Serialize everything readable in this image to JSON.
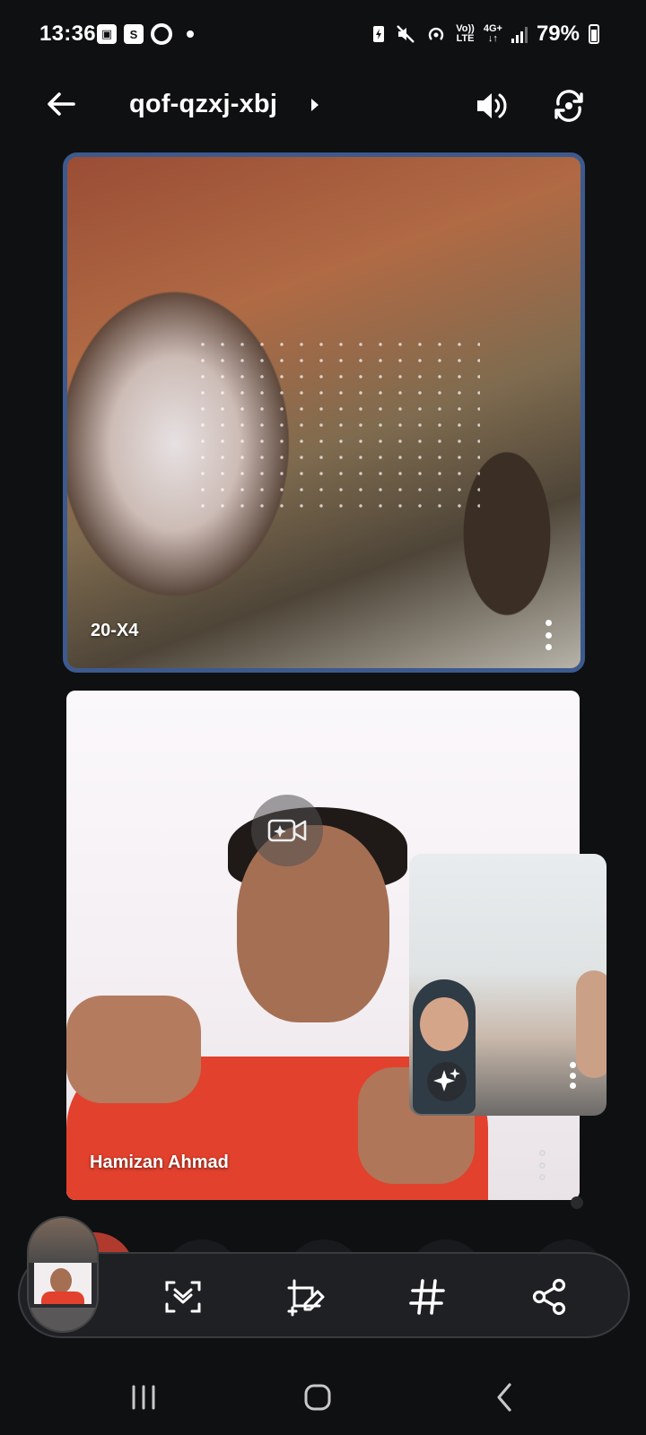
{
  "status_bar": {
    "time": "13:36",
    "battery": "79%",
    "volte_top": "Vo))",
    "volte_bottom": "LTE",
    "net_top": "4G+",
    "net_bottom": "↓↑"
  },
  "header": {
    "meeting_code": "qof-qzxj-xbj",
    "icons": [
      "back-arrow-icon",
      "caret-right-icon",
      "speaker-icon",
      "switch-camera-icon"
    ]
  },
  "tiles": [
    {
      "name": "20-X4"
    },
    {
      "name": "Hamizan Ahmad"
    }
  ],
  "toolbar": {
    "icons": [
      "auto-frame-icon",
      "annotate-icon",
      "hashtag-icon",
      "share-icon"
    ]
  },
  "colors": {
    "background": "#0f1012",
    "active_speaker_border": "#3c5a8e",
    "toolbar": "#1f2023",
    "end_call": "#b13a2e"
  }
}
